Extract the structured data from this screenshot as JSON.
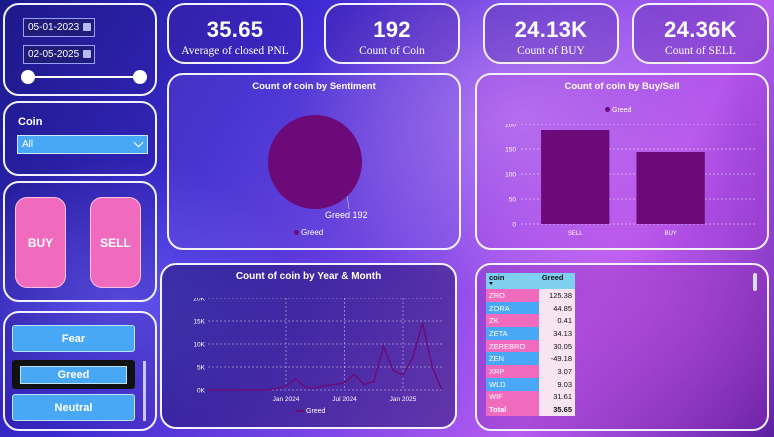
{
  "filters": {
    "start_date": "05-01-2023",
    "end_date": "02-05-2025",
    "coin_label": "Coin",
    "coin_value": "All"
  },
  "buttons": {
    "buy": "BUY",
    "sell": "SELL"
  },
  "sentiment_buttons": [
    {
      "label": "Fear"
    },
    {
      "label": "Greed"
    },
    {
      "label": "Neutral"
    }
  ],
  "kpis": [
    {
      "value": "35.65",
      "label": "Average of closed PNL"
    },
    {
      "value": "192",
      "label": "Count of Coin"
    },
    {
      "value": "24.13K",
      "label": "Count of BUY"
    },
    {
      "value": "24.36K",
      "label": "Count of SELL"
    }
  ],
  "colors": {
    "series": "#6b0a78",
    "pink": "#f06bbd",
    "blue": "#49a8f5"
  },
  "chart_data": [
    {
      "type": "pie",
      "title": "Count of coin by Sentiment",
      "legend": [
        "Greed"
      ],
      "slices": [
        {
          "label": "Greed",
          "value": 192
        }
      ],
      "data_label": "Greed 192"
    },
    {
      "type": "bar",
      "title": "Count of coin by Buy/Sell",
      "legend": [
        "Greed"
      ],
      "categories": [
        "SELL",
        "BUY"
      ],
      "values": [
        188,
        144
      ],
      "ylim": [
        0,
        200
      ],
      "yticks": [
        "200",
        "150",
        "100",
        "50",
        "0"
      ]
    },
    {
      "type": "line",
      "title": "Count of coin by Year & Month",
      "legend": [
        "Greed"
      ],
      "xticks": [
        "Jan 2024",
        "Jul 2024",
        "Jan 2025"
      ],
      "yticks": [
        "20K",
        "15K",
        "10K",
        "5K",
        "0K"
      ],
      "ylim": [
        0,
        20000
      ],
      "x": [
        "2023-05",
        "2023-06",
        "2023-07",
        "2023-08",
        "2023-09",
        "2023-10",
        "2023-11",
        "2023-12",
        "2024-01",
        "2024-02",
        "2024-03",
        "2024-04",
        "2024-05",
        "2024-06",
        "2024-07",
        "2024-08",
        "2024-09",
        "2024-10",
        "2024-11",
        "2024-12",
        "2025-01",
        "2025-02",
        "2025-03",
        "2025-04",
        "2025-05"
      ],
      "values": [
        0,
        0,
        0,
        0,
        0,
        0,
        0,
        300,
        800,
        2400,
        600,
        400,
        900,
        1200,
        1600,
        3400,
        1200,
        1800,
        9500,
        4200,
        3300,
        7000,
        14600,
        5000,
        0
      ]
    },
    {
      "type": "table",
      "columns": [
        "coin",
        "Greed"
      ],
      "rows": [
        [
          "ZRO",
          "125.38"
        ],
        [
          "ZORA",
          "44.85"
        ],
        [
          "ZK",
          "0.41"
        ],
        [
          "ZETA",
          "34.13"
        ],
        [
          "ZEREBRO",
          "30.05"
        ],
        [
          "ZEN",
          "-49.18"
        ],
        [
          "XRP",
          "3.07"
        ],
        [
          "WLD",
          "9.03"
        ],
        [
          "WIF",
          "31.61"
        ]
      ],
      "total": [
        "Total",
        "35.65"
      ]
    }
  ]
}
